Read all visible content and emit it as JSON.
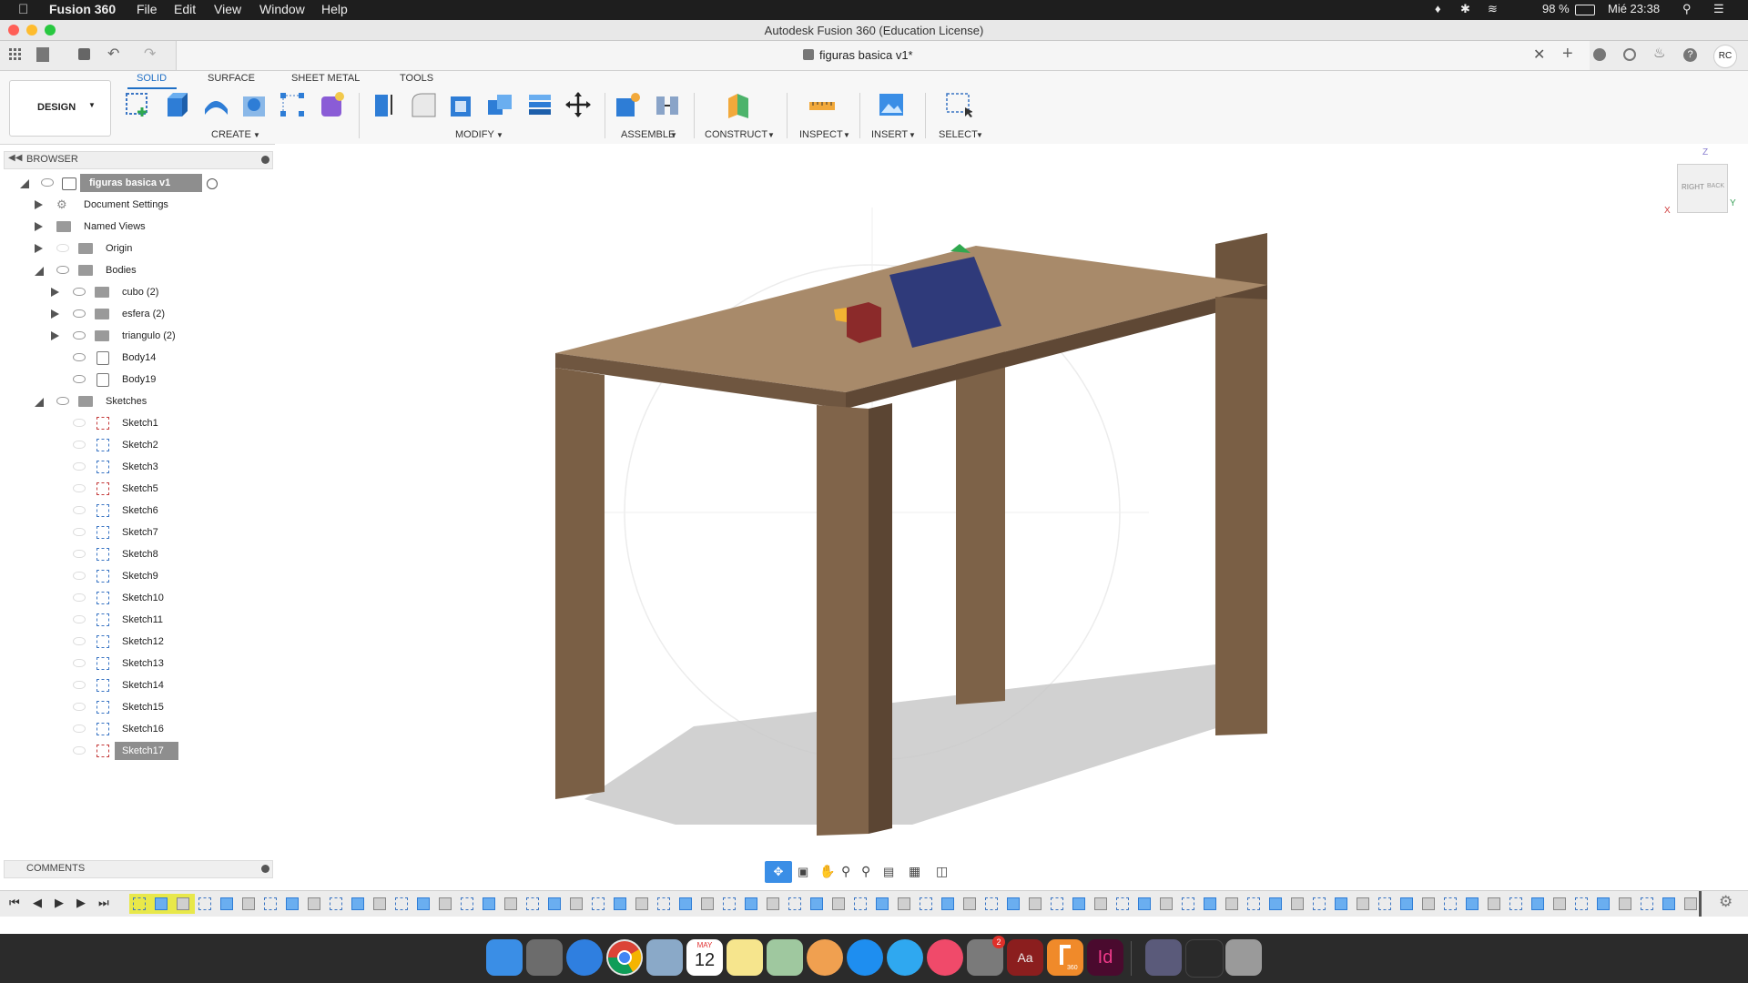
{
  "menubar": {
    "apple": "",
    "app_name": "Fusion 360",
    "items": [
      "File",
      "Edit",
      "View",
      "Window",
      "Help"
    ],
    "battery": "98 %",
    "clock": "Mié 23:38"
  },
  "titlebar": {
    "title": "Autodesk Fusion 360 (Education License)"
  },
  "appbar": {
    "doc_title": "figuras basica v1*",
    "user": "RC"
  },
  "toolbar": {
    "workspace": "DESIGN",
    "tabs": [
      "SOLID",
      "SURFACE",
      "SHEET METAL",
      "TOOLS"
    ],
    "groups": [
      "CREATE",
      "MODIFY",
      "ASSEMBLE",
      "CONSTRUCT",
      "INSPECT",
      "INSERT",
      "SELECT"
    ]
  },
  "browser": {
    "header": "BROWSER",
    "root": "figuras basica v1",
    "items": [
      "Document Settings",
      "Named Views",
      "Origin",
      "Bodies",
      "cubo (2)",
      "esfera (2)",
      "triangulo (2)",
      "Body14",
      "Body19",
      "Sketches"
    ],
    "sketches": [
      "Sketch1",
      "Sketch2",
      "Sketch3",
      "Sketch5",
      "Sketch6",
      "Sketch7",
      "Sketch8",
      "Sketch9",
      "Sketch10",
      "Sketch11",
      "Sketch12",
      "Sketch13",
      "Sketch14",
      "Sketch15",
      "Sketch16",
      "Sketch17"
    ],
    "comments": "COMMENTS"
  },
  "viewcube": {
    "top": "Z",
    "right": "RIGHT",
    "back": "BACK",
    "x": "X",
    "y": "Y"
  },
  "dock": {
    "calendar_month": "MAY",
    "calendar_day": "12",
    "badge": "2",
    "app_aa": "Aa",
    "app_id": "Id",
    "fusion_label": "360"
  }
}
